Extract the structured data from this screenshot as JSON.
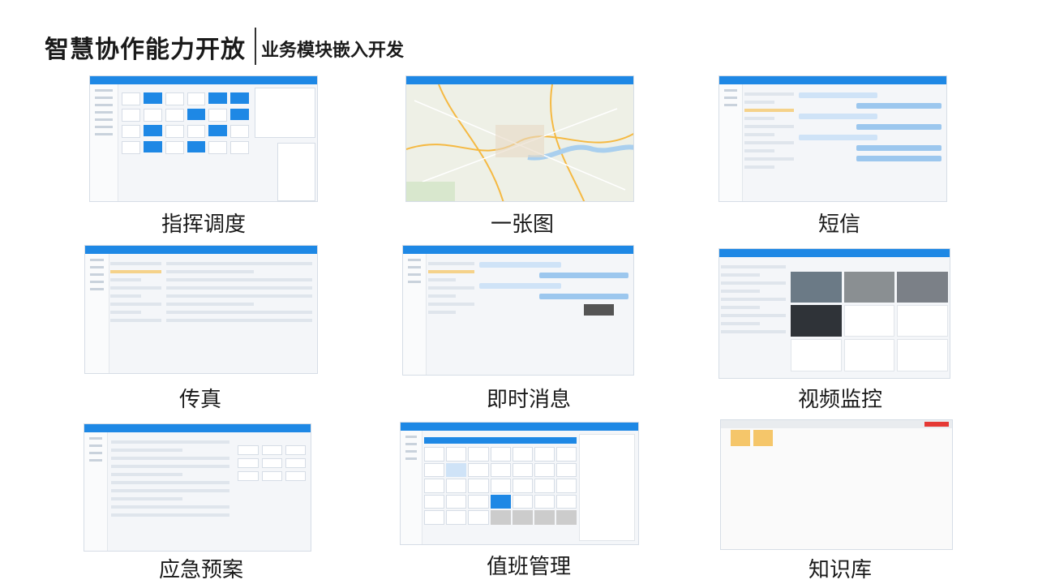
{
  "header": {
    "title": "智慧协作能力开放",
    "subtitle": "业务模块嵌入开发"
  },
  "modules": [
    {
      "label": "指挥调度"
    },
    {
      "label": "一张图"
    },
    {
      "label": "短信"
    },
    {
      "label": "传真"
    },
    {
      "label": "即时消息"
    },
    {
      "label": "视频监控"
    },
    {
      "label": "应急预案"
    },
    {
      "label": "值班管理"
    },
    {
      "label": "知识库"
    }
  ],
  "colors": {
    "accent": "#1e88e5",
    "highlight": "#f5a623"
  }
}
